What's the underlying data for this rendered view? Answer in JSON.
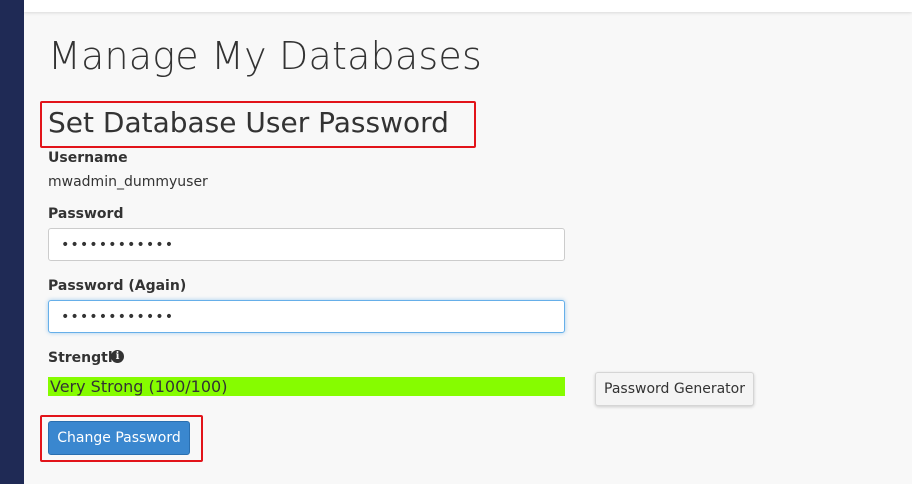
{
  "page": {
    "title": "Manage My Databases",
    "section_heading": "Set Database User Password"
  },
  "form": {
    "username_label": "Username",
    "username_value": "mwadmin_dummyuser",
    "password_label": "Password",
    "password_value": "••••••••••••",
    "password_again_label": "Password (Again)",
    "password_again_value": "••••••••••••",
    "strength_label": "Strength",
    "strength_text": "Very Strong (100/100)",
    "strength_score": 100,
    "strength_color": "#86fc00",
    "password_generator_label": "Password Generator",
    "change_password_label": "Change Password"
  },
  "colors": {
    "accent": "#3a87cf",
    "highlight": "#e2141a",
    "sidebar": "#1f2a55"
  },
  "icons": {
    "strength_help": "info-circle-icon"
  }
}
